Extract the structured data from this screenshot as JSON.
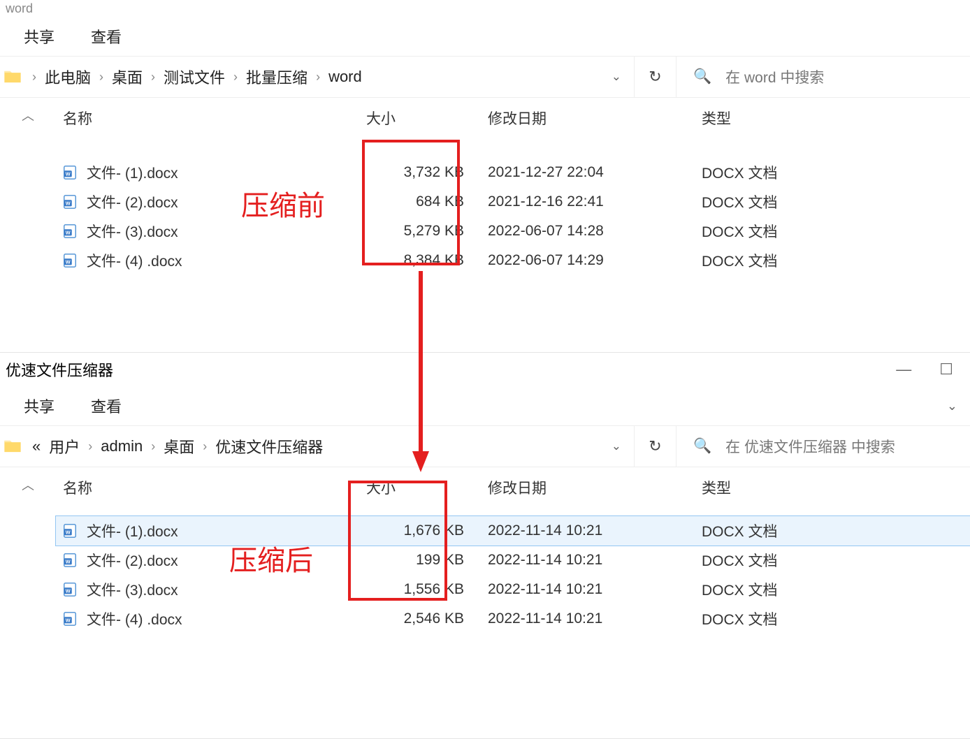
{
  "window1": {
    "title": "word",
    "ribbon": {
      "tab_share": "共享",
      "tab_view": "查看"
    },
    "breadcrumb": {
      "items": [
        "此电脑",
        "桌面",
        "测试文件",
        "批量压缩",
        "word"
      ],
      "prefix_double": false
    },
    "search_placeholder": "在 word 中搜索",
    "columns": {
      "name": "名称",
      "size": "大小",
      "modified": "修改日期",
      "type": "类型"
    },
    "files": [
      {
        "name": "文件- (1).docx",
        "size": "3,732 KB",
        "modified": "2021-12-27 22:04",
        "type": "DOCX 文档"
      },
      {
        "name": "文件- (2).docx",
        "size": "684 KB",
        "modified": "2021-12-16 22:41",
        "type": "DOCX 文档"
      },
      {
        "name": "文件- (3).docx",
        "size": "5,279 KB",
        "modified": "2022-06-07 14:28",
        "type": "DOCX 文档"
      },
      {
        "name": "文件- (4) .docx",
        "size": "8,384 KB",
        "modified": "2022-06-07 14:29",
        "type": "DOCX 文档"
      }
    ]
  },
  "window2": {
    "title": "优速文件压缩器",
    "ribbon": {
      "tab_share": "共享",
      "tab_view": "查看"
    },
    "breadcrumb": {
      "items": [
        "用户",
        "admin",
        "桌面",
        "优速文件压缩器"
      ],
      "prefix_double": true
    },
    "search_placeholder": "在 优速文件压缩器 中搜索",
    "columns": {
      "name": "名称",
      "size": "大小",
      "modified": "修改日期",
      "type": "类型"
    },
    "files": [
      {
        "name": "文件- (1).docx",
        "size": "1,676 KB",
        "modified": "2022-11-14 10:21",
        "type": "DOCX 文档",
        "selected": true
      },
      {
        "name": "文件- (2).docx",
        "size": "199 KB",
        "modified": "2022-11-14 10:21",
        "type": "DOCX 文档"
      },
      {
        "name": "文件- (3).docx",
        "size": "1,556 KB",
        "modified": "2022-11-14 10:21",
        "type": "DOCX 文档"
      },
      {
        "name": "文件- (4) .docx",
        "size": "2,546 KB",
        "modified": "2022-11-14 10:21",
        "type": "DOCX 文档"
      }
    ]
  },
  "annotations": {
    "before": "压缩前",
    "after": "压缩后"
  }
}
